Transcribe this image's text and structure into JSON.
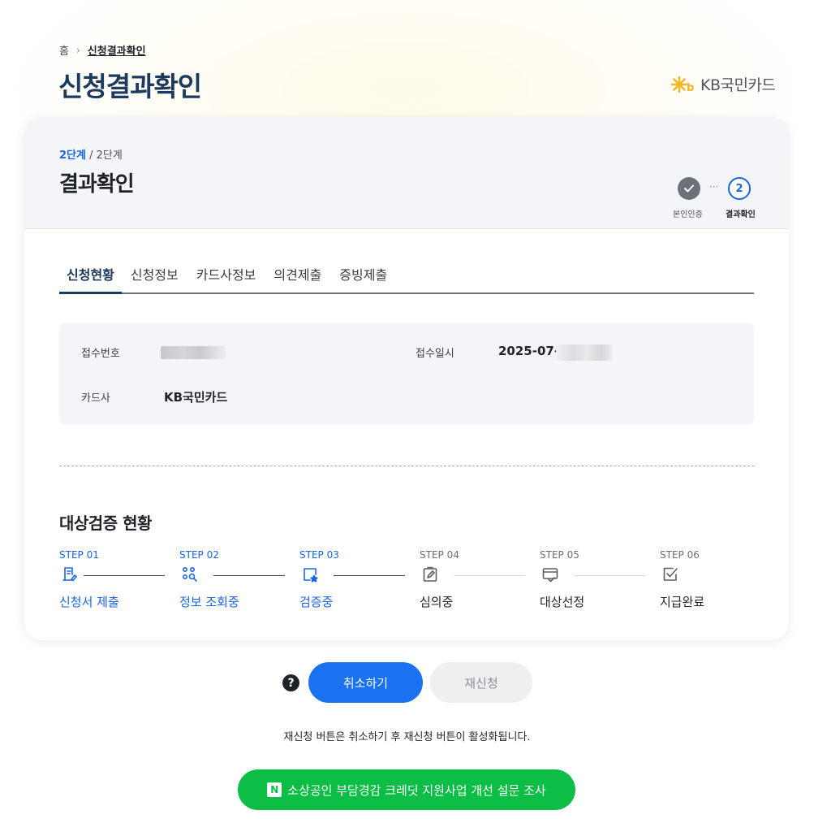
{
  "breadcrumb": {
    "home": "홈",
    "current": "신청결과확인"
  },
  "page_title": "신청결과확인",
  "brand": {
    "name": "KB국민카드",
    "color": "#f4b51b"
  },
  "card": {
    "step_current": "2단계",
    "step_total": " / 2단계",
    "title": "결과확인",
    "progress": {
      "done_label": "본인인증",
      "dots": "···",
      "current_number": "2",
      "current_label": "결과확인"
    }
  },
  "tabs": [
    {
      "label": "신청현황",
      "active": true
    },
    {
      "label": "신청정보",
      "active": false
    },
    {
      "label": "카드사정보",
      "active": false
    },
    {
      "label": "의견제출",
      "active": false
    },
    {
      "label": "증빙제출",
      "active": false
    }
  ],
  "info": {
    "receipt_number_label": "접수번호",
    "receipt_date_label": "접수일시",
    "receipt_date_value": "2025-07-",
    "card_company_label": "카드사",
    "card_company_value": "KB국민카드"
  },
  "verification": {
    "title": "대상검증 현황",
    "steps": [
      {
        "number": "STEP 01",
        "name": "신청서 제출",
        "icon": "application-form-icon",
        "active": true
      },
      {
        "number": "STEP 02",
        "name": "정보 조회중",
        "icon": "search-info-icon",
        "active": true
      },
      {
        "number": "STEP 03",
        "name": "검증중",
        "icon": "verify-star-icon",
        "active": true
      },
      {
        "number": "STEP 04",
        "name": "심의중",
        "icon": "clipboard-edit-icon",
        "active": false
      },
      {
        "number": "STEP 05",
        "name": "대상선정",
        "icon": "card-check-icon",
        "active": false
      },
      {
        "number": "STEP 06",
        "name": "지급완료",
        "icon": "checkbox-icon",
        "active": false
      }
    ]
  },
  "actions": {
    "help": "?",
    "cancel_label": "취소하기",
    "reapply_label": "재신청",
    "notice": "재신청 버튼은 취소하기 후 재신청 버튼이 활성화됩니다.",
    "survey_badge": "N",
    "survey_label": "소상공인 부담경감 크레딧 지원사업 개선 설문 조사"
  },
  "colors": {
    "accent_blue": "#1a72f0",
    "title_navy": "#1c3a5c",
    "survey_green": "#0cbe46"
  }
}
